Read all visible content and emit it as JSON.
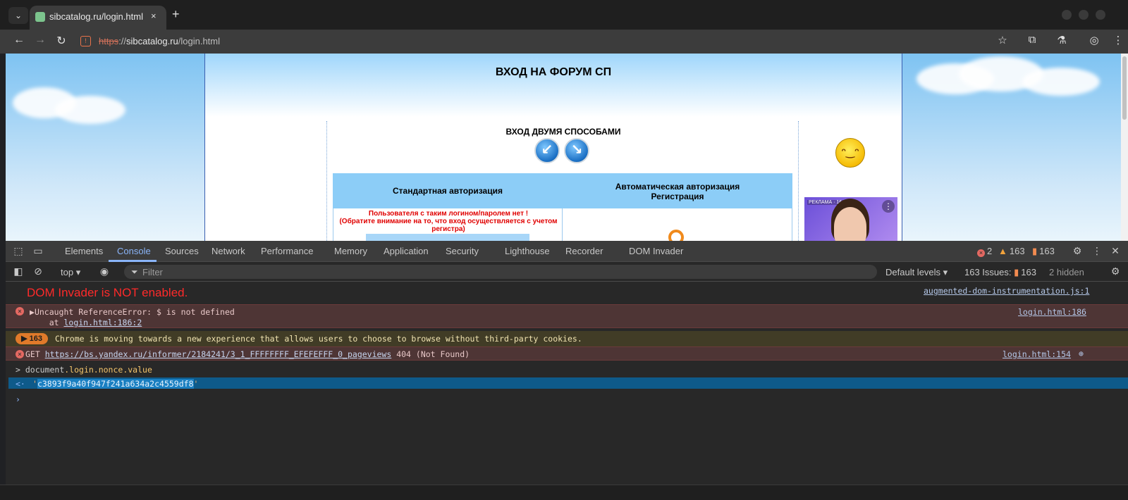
{
  "browser": {
    "tab_title": "sibcatalog.ru/login.html",
    "tab_close": "×",
    "new_tab": "+",
    "dropdown": "⌄",
    "url_scheme": "https",
    "url_sep": "://",
    "url_host": "sibcatalog.ru",
    "url_path": "/login.html"
  },
  "page": {
    "title": "ВХОД НА ФОРУМ СП",
    "two_ways": "ВХОД ДВУМЯ СПОСОБАМИ",
    "standard_auth": "Стандартная авторизация",
    "auto_auth_line1": "Автоматическая авторизация",
    "auto_auth_line2": "Регистрация",
    "error_line1": "Пользователя с таким логином/паролем нет !",
    "error_line2": "(Обратите внимание на то, что вход осуществляется с учетом регистра)",
    "ad_label": "РЕКЛАМА · 16+"
  },
  "devtools": {
    "tabs": [
      "Elements",
      "Console",
      "Sources",
      "Network",
      "Performance",
      "Memory",
      "Application",
      "Security",
      "Lighthouse",
      "Recorder",
      "DOM Invader"
    ],
    "active_tab": "Console",
    "errors_count": "2",
    "warnings_count": "163",
    "issues_count": "163",
    "context": "top",
    "filter_placeholder": "Filter",
    "levels": "Default levels",
    "issues_label": "163 Issues:",
    "issues_badge": "163",
    "hidden": "2 hidden"
  },
  "console": {
    "dom_invader": "DOM Invader is NOT enabled.",
    "dom_invader_src": "augmented-dom-instrumentation.js:1",
    "err1_text": "Uncaught ReferenceError: $ is not defined",
    "err1_at": "    at ",
    "err1_at_link": "login.html:186:2",
    "err1_src": "login.html:186",
    "warn_badge": "163",
    "warn_text": "Chrome is moving towards a new experience that allows users to choose to browse without third-party cookies.",
    "get_prefix": "GET ",
    "get_url": "https://bs.yandex.ru/informer/2184241/3_1_FFFFFFFF_EFEFEFFF_0_pageviews",
    "get_status": " 404 (Not Found)",
    "get_src": "login.html:154",
    "cmd_object": "document",
    "cmd_path": ".login.nonce.value",
    "result_value": "c3893f9a40f947f241a634a2c4559df8"
  },
  "colors": {
    "accent": "#8ab4f8",
    "error": "#e46962",
    "warning": "#f2a33c",
    "dom_invader_red": "#ff2a2a"
  }
}
